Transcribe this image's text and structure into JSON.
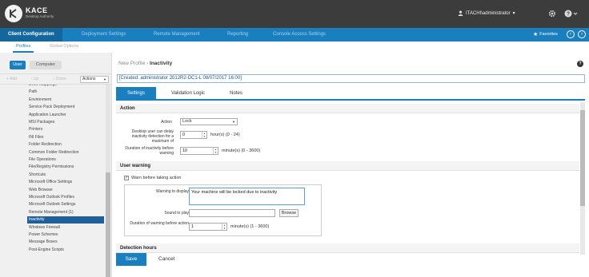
{
  "header": {
    "brand": "KACE",
    "brand_sub": "Desktop Authority",
    "user": "ITACHI\\administrator",
    "user_caret": "▾",
    "icons": [
      "user-icon",
      "gear-icon",
      "help-icon",
      "chevron-down-icon"
    ]
  },
  "nav": {
    "items": [
      "Client Configuration",
      "Deployment Settings",
      "Remote Management",
      "Reporting",
      "Console Access Settings"
    ],
    "favorites": "Favorites"
  },
  "subtabs": [
    "Profiles",
    "Global Options"
  ],
  "left": {
    "tabs": [
      "User",
      "Computer"
    ],
    "tools": [
      "+ Add",
      "↑ Up",
      "↓ Down"
    ],
    "actions": "Actions",
    "tree": [
      "Drive Mappings",
      "Path",
      "Environment",
      "Service Pack Deployment",
      "Application Launcher",
      "MSI Packages",
      "Printers",
      "INI Files",
      "Folder Redirection",
      "Common Folder Redirection",
      "File Operations",
      "File/Registry Permissions",
      "Shortcuts",
      "Microsoft Office Settings",
      "Web Browser",
      "Microsoft Outlook Profiles",
      "Microsoft Outlook Settings",
      "Remote Management (1)",
      "Inactivity",
      "Windows Firewall",
      "Power Schemes",
      "Message Boxes",
      "Post-Engine Scripts"
    ],
    "selected_index": 18
  },
  "main": {
    "title_prefix": "New Profile",
    "title_sep": "›",
    "title": "Inactivity",
    "help": "?",
    "created": "[Created: administrator 2012R2-DC1-L 08/07/2017 16:00]",
    "tabs": [
      "Settings",
      "Validation Logic",
      "Notes"
    ],
    "action_section": "Action",
    "action_label": "Action",
    "action_value": "Lock",
    "delay_label": "Desktop user can delay inactivity detection for a maximum of",
    "delay_value": "0",
    "delay_unit": "hour(s) (0 - 24)",
    "duration_label": "Duration of inactivity before warning",
    "duration_value": "10",
    "duration_unit": "minute(s) (0 - 3600)",
    "warning_section": "User warning",
    "warn_checkbox": "Warn before taking action",
    "warn_checked": true,
    "warning_display_label": "Warning to display",
    "warning_display_value": "Your machine will be locked due to inactivity",
    "sound_label": "Sound to play",
    "sound_value": "",
    "browse": "Browse",
    "warn_duration_label": "Duration of warning before action",
    "warn_duration_value": "1",
    "warn_duration_unit": "minute(s) (1 - 3600)",
    "detection_section": "Detection hours",
    "save": "Save",
    "cancel": "Cancel"
  },
  "colors": {
    "accent": "#1a7fbf",
    "topbar": "#3c3c3c",
    "selected": "#1f5f9c"
  }
}
